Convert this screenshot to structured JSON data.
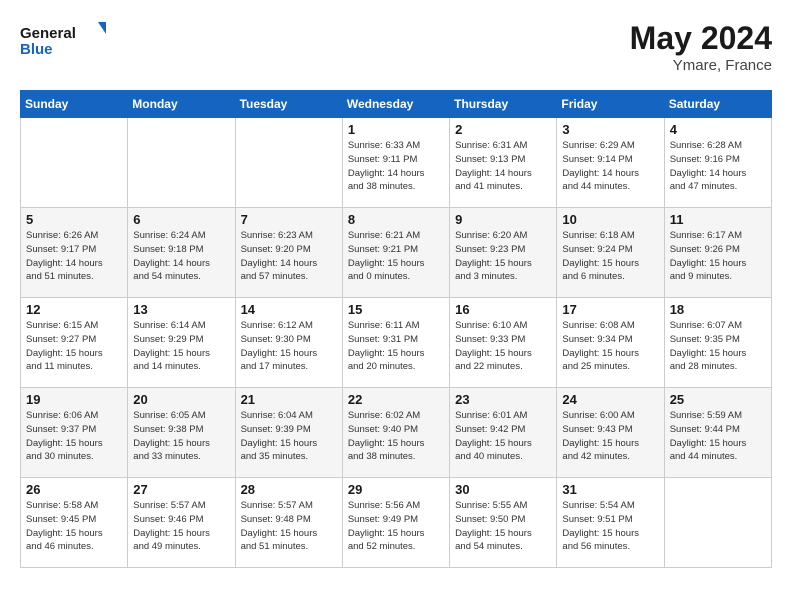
{
  "header": {
    "logo_line1": "General",
    "logo_line2": "Blue",
    "month_year": "May 2024",
    "location": "Ymare, France"
  },
  "weekdays": [
    "Sunday",
    "Monday",
    "Tuesday",
    "Wednesday",
    "Thursday",
    "Friday",
    "Saturday"
  ],
  "weeks": [
    [
      {
        "day": "",
        "info": ""
      },
      {
        "day": "",
        "info": ""
      },
      {
        "day": "",
        "info": ""
      },
      {
        "day": "1",
        "info": "Sunrise: 6:33 AM\nSunset: 9:11 PM\nDaylight: 14 hours\nand 38 minutes."
      },
      {
        "day": "2",
        "info": "Sunrise: 6:31 AM\nSunset: 9:13 PM\nDaylight: 14 hours\nand 41 minutes."
      },
      {
        "day": "3",
        "info": "Sunrise: 6:29 AM\nSunset: 9:14 PM\nDaylight: 14 hours\nand 44 minutes."
      },
      {
        "day": "4",
        "info": "Sunrise: 6:28 AM\nSunset: 9:16 PM\nDaylight: 14 hours\nand 47 minutes."
      }
    ],
    [
      {
        "day": "5",
        "info": "Sunrise: 6:26 AM\nSunset: 9:17 PM\nDaylight: 14 hours\nand 51 minutes."
      },
      {
        "day": "6",
        "info": "Sunrise: 6:24 AM\nSunset: 9:18 PM\nDaylight: 14 hours\nand 54 minutes."
      },
      {
        "day": "7",
        "info": "Sunrise: 6:23 AM\nSunset: 9:20 PM\nDaylight: 14 hours\nand 57 minutes."
      },
      {
        "day": "8",
        "info": "Sunrise: 6:21 AM\nSunset: 9:21 PM\nDaylight: 15 hours\nand 0 minutes."
      },
      {
        "day": "9",
        "info": "Sunrise: 6:20 AM\nSunset: 9:23 PM\nDaylight: 15 hours\nand 3 minutes."
      },
      {
        "day": "10",
        "info": "Sunrise: 6:18 AM\nSunset: 9:24 PM\nDaylight: 15 hours\nand 6 minutes."
      },
      {
        "day": "11",
        "info": "Sunrise: 6:17 AM\nSunset: 9:26 PM\nDaylight: 15 hours\nand 9 minutes."
      }
    ],
    [
      {
        "day": "12",
        "info": "Sunrise: 6:15 AM\nSunset: 9:27 PM\nDaylight: 15 hours\nand 11 minutes."
      },
      {
        "day": "13",
        "info": "Sunrise: 6:14 AM\nSunset: 9:29 PM\nDaylight: 15 hours\nand 14 minutes."
      },
      {
        "day": "14",
        "info": "Sunrise: 6:12 AM\nSunset: 9:30 PM\nDaylight: 15 hours\nand 17 minutes."
      },
      {
        "day": "15",
        "info": "Sunrise: 6:11 AM\nSunset: 9:31 PM\nDaylight: 15 hours\nand 20 minutes."
      },
      {
        "day": "16",
        "info": "Sunrise: 6:10 AM\nSunset: 9:33 PM\nDaylight: 15 hours\nand 22 minutes."
      },
      {
        "day": "17",
        "info": "Sunrise: 6:08 AM\nSunset: 9:34 PM\nDaylight: 15 hours\nand 25 minutes."
      },
      {
        "day": "18",
        "info": "Sunrise: 6:07 AM\nSunset: 9:35 PM\nDaylight: 15 hours\nand 28 minutes."
      }
    ],
    [
      {
        "day": "19",
        "info": "Sunrise: 6:06 AM\nSunset: 9:37 PM\nDaylight: 15 hours\nand 30 minutes."
      },
      {
        "day": "20",
        "info": "Sunrise: 6:05 AM\nSunset: 9:38 PM\nDaylight: 15 hours\nand 33 minutes."
      },
      {
        "day": "21",
        "info": "Sunrise: 6:04 AM\nSunset: 9:39 PM\nDaylight: 15 hours\nand 35 minutes."
      },
      {
        "day": "22",
        "info": "Sunrise: 6:02 AM\nSunset: 9:40 PM\nDaylight: 15 hours\nand 38 minutes."
      },
      {
        "day": "23",
        "info": "Sunrise: 6:01 AM\nSunset: 9:42 PM\nDaylight: 15 hours\nand 40 minutes."
      },
      {
        "day": "24",
        "info": "Sunrise: 6:00 AM\nSunset: 9:43 PM\nDaylight: 15 hours\nand 42 minutes."
      },
      {
        "day": "25",
        "info": "Sunrise: 5:59 AM\nSunset: 9:44 PM\nDaylight: 15 hours\nand 44 minutes."
      }
    ],
    [
      {
        "day": "26",
        "info": "Sunrise: 5:58 AM\nSunset: 9:45 PM\nDaylight: 15 hours\nand 46 minutes."
      },
      {
        "day": "27",
        "info": "Sunrise: 5:57 AM\nSunset: 9:46 PM\nDaylight: 15 hours\nand 49 minutes."
      },
      {
        "day": "28",
        "info": "Sunrise: 5:57 AM\nSunset: 9:48 PM\nDaylight: 15 hours\nand 51 minutes."
      },
      {
        "day": "29",
        "info": "Sunrise: 5:56 AM\nSunset: 9:49 PM\nDaylight: 15 hours\nand 52 minutes."
      },
      {
        "day": "30",
        "info": "Sunrise: 5:55 AM\nSunset: 9:50 PM\nDaylight: 15 hours\nand 54 minutes."
      },
      {
        "day": "31",
        "info": "Sunrise: 5:54 AM\nSunset: 9:51 PM\nDaylight: 15 hours\nand 56 minutes."
      },
      {
        "day": "",
        "info": ""
      }
    ]
  ]
}
